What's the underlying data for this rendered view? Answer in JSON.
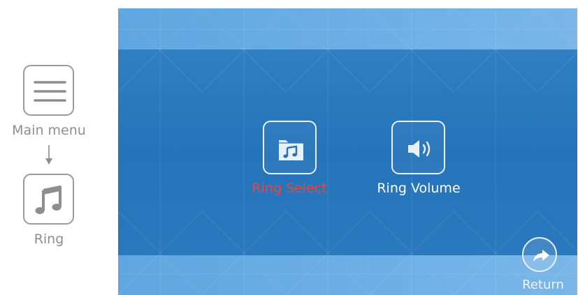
{
  "guide": {
    "main_menu_label": "Main menu",
    "ring_label": "Ring",
    "main_menu_icon": "hamburger-menu-icon",
    "ring_icon": "music-note-icon",
    "arrow_icon": "down-arrow-icon"
  },
  "screen": {
    "items": [
      {
        "label": "Ring Select",
        "icon": "music-folder-icon",
        "selected": true
      },
      {
        "label": "Ring Volume",
        "icon": "speaker-volume-icon",
        "selected": false
      }
    ],
    "return_label": "Return",
    "return_icon": "return-arrow-icon"
  },
  "colors": {
    "selected_text": "#e8473f",
    "normal_text": "#ffffff",
    "screen_background": "#2474b9",
    "band": "#6eb0e6",
    "guide_text": "#8e8e8e"
  }
}
